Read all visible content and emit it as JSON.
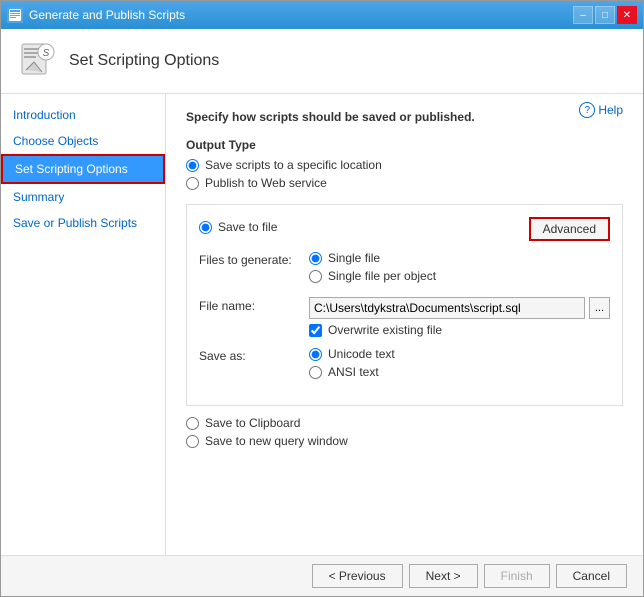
{
  "window": {
    "title": "Generate and Publish Scripts",
    "controls": {
      "minimize": "–",
      "maximize": "□",
      "close": "✕"
    }
  },
  "header": {
    "title": "Set Scripting Options",
    "icon": "📜"
  },
  "help": {
    "label": "Help"
  },
  "sidebar": {
    "items": [
      {
        "id": "introduction",
        "label": "Introduction",
        "active": false
      },
      {
        "id": "choose-objects",
        "label": "Choose Objects",
        "active": false
      },
      {
        "id": "set-scripting-options",
        "label": "Set Scripting Options",
        "active": true
      },
      {
        "id": "summary",
        "label": "Summary",
        "active": false
      },
      {
        "id": "save-or-publish",
        "label": "Save or Publish Scripts",
        "active": false
      }
    ]
  },
  "main": {
    "description": "Specify how scripts should be saved or published.",
    "output_type": {
      "label": "Output Type",
      "options": [
        {
          "id": "save-location",
          "label": "Save scripts to a specific location",
          "checked": true
        },
        {
          "id": "publish-web",
          "label": "Publish to Web service",
          "checked": false
        }
      ]
    },
    "save_to_file": {
      "label": "Save to file",
      "checked": true,
      "advanced_btn": "Advanced",
      "files_to_generate": {
        "label": "Files to generate:",
        "options": [
          {
            "id": "single-file",
            "label": "Single file",
            "checked": true
          },
          {
            "id": "single-file-per-object",
            "label": "Single file per object",
            "checked": false
          }
        ]
      },
      "file_name": {
        "label": "File name:",
        "value": "C:\\Users\\tdykstra\\Documents\\script.sql",
        "browse_label": "..."
      },
      "overwrite": {
        "label": "Overwrite existing file",
        "checked": true
      },
      "save_as": {
        "label": "Save as:",
        "options": [
          {
            "id": "unicode",
            "label": "Unicode text",
            "checked": true
          },
          {
            "id": "ansi",
            "label": "ANSI text",
            "checked": false
          }
        ]
      }
    },
    "other_options": [
      {
        "id": "clipboard",
        "label": "Save to Clipboard",
        "checked": false
      },
      {
        "id": "query-window",
        "label": "Save to new query window",
        "checked": false
      }
    ]
  },
  "footer": {
    "previous": "< Previous",
    "next": "Next >",
    "finish": "Finish",
    "cancel": "Cancel"
  }
}
